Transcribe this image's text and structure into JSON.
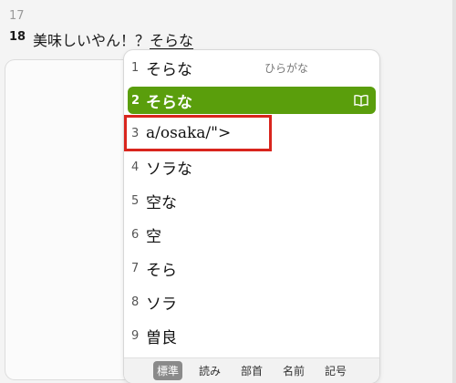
{
  "editor": {
    "line17_number": "17",
    "line18_number": "18",
    "line18_text": "美味しいやん！？",
    "composing_text": "そらな"
  },
  "candidates": [
    {
      "num": "1",
      "word": "そらな",
      "hint": "ひらがな"
    },
    {
      "num": "2",
      "word": "そらな",
      "hint": ""
    },
    {
      "num": "3",
      "word": "a/osaka/\">",
      "hint": ""
    },
    {
      "num": "4",
      "word": "ソラな",
      "hint": ""
    },
    {
      "num": "5",
      "word": "空な",
      "hint": ""
    },
    {
      "num": "6",
      "word": "空",
      "hint": ""
    },
    {
      "num": "7",
      "word": "そら",
      "hint": ""
    },
    {
      "num": "8",
      "word": "ソラ",
      "hint": ""
    },
    {
      "num": "9",
      "word": "曽良",
      "hint": ""
    }
  ],
  "tabs": [
    "標準",
    "読み",
    "部首",
    "名前",
    "記号"
  ],
  "colors": {
    "selected_bg": "#5a9e0c",
    "highlight_border": "#d9251d"
  },
  "icons": {
    "dictionary": "book-icon"
  }
}
